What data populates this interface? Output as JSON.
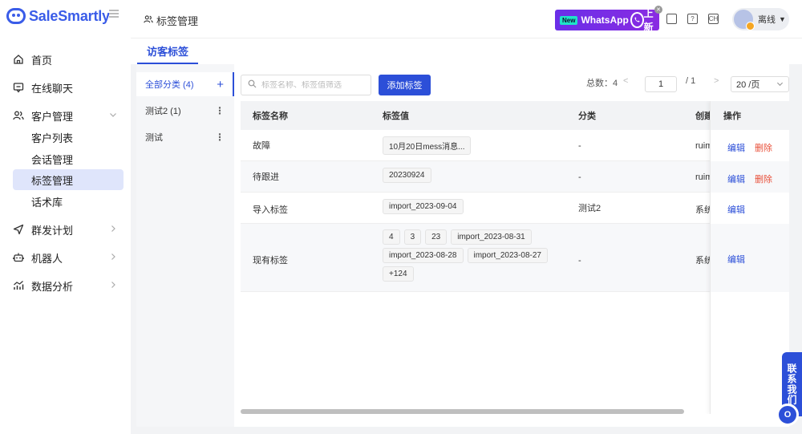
{
  "app": {
    "logo_text": "SaleSmartly"
  },
  "sidebar": {
    "items": [
      {
        "label": "首页",
        "icon": "home-icon"
      },
      {
        "label": "在线聊天",
        "icon": "chat-icon"
      },
      {
        "label": "客户管理",
        "icon": "users-icon",
        "expanded": true,
        "children": [
          {
            "label": "客户列表"
          },
          {
            "label": "会话管理"
          },
          {
            "label": "标签管理",
            "active": true
          },
          {
            "label": "话术库"
          }
        ]
      },
      {
        "label": "群发计划",
        "icon": "send-icon"
      },
      {
        "label": "机器人",
        "icon": "robot-icon"
      },
      {
        "label": "数据分析",
        "icon": "chart-icon"
      }
    ]
  },
  "header": {
    "breadcrumb": "标签管理",
    "banner": {
      "new_badge": "New",
      "text": "WhatsApp",
      "suffix": "上新"
    },
    "user": {
      "status": "离线"
    }
  },
  "tabs": [
    {
      "label": "访客标签",
      "active": true
    }
  ],
  "categories": [
    {
      "label": "全部分类 (4)",
      "active": true,
      "action": "+"
    },
    {
      "label": "测试2 (1)",
      "action": "⋮"
    },
    {
      "label": "测试",
      "action": "⋮"
    }
  ],
  "toolbar": {
    "search_placeholder": "标签名称、标签值筛选",
    "add_button": "添加标签"
  },
  "pagination": {
    "total_label": "总数：4",
    "current_page": "1",
    "total_pages": "/ 1",
    "page_size": "20 /页",
    "prev": "<",
    "next": ">"
  },
  "table": {
    "columns": [
      "标签名称",
      "标签值",
      "分类",
      "创建",
      "操作"
    ],
    "rows": [
      {
        "name": "故障",
        "values": [
          "10月20日mess消息..."
        ],
        "category": "-",
        "creator": "ruim",
        "actions": [
          "编辑",
          "删除"
        ]
      },
      {
        "name": "待跟进",
        "values": [
          "20230924"
        ],
        "category": "-",
        "creator": "ruim",
        "actions": [
          "编辑",
          "删除"
        ]
      },
      {
        "name": "导入标签",
        "values": [
          "import_2023-09-04"
        ],
        "category": "测试2",
        "creator": "系统",
        "actions": [
          "编辑"
        ]
      },
      {
        "name": "现有标签",
        "values": [
          "4",
          "3",
          "23",
          "import_2023-08-31",
          "import_2023-08-28",
          "import_2023-08-27",
          "+124"
        ],
        "category": "-",
        "creator": "系统",
        "actions": [
          "编辑"
        ]
      }
    ]
  },
  "contact": {
    "label": "联系我们",
    "icon_char": "O"
  },
  "colors": {
    "primary": "#2c4fd8",
    "danger": "#e8503a",
    "active_nav_bg": "#dfe5fb",
    "banner": "#7b2fe8"
  }
}
